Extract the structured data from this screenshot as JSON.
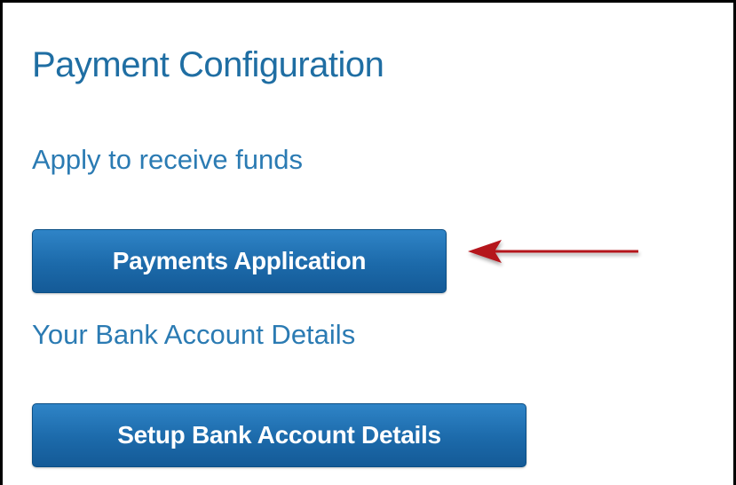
{
  "page": {
    "title": "Payment Configuration"
  },
  "sections": {
    "funds": {
      "label": "Apply to receive funds",
      "button_label": "Payments Application"
    },
    "bank": {
      "label": "Your Bank Account Details",
      "button_label": "Setup Bank Account Details"
    }
  },
  "annotation": {
    "icon": "arrow-left-icon",
    "color": "#b5121b"
  },
  "colors": {
    "heading": "#1f6ea3",
    "button": "#1c6aaa",
    "button_text": "#ffffff"
  }
}
